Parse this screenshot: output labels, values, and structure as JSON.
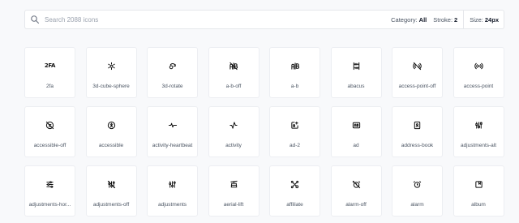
{
  "search": {
    "placeholder": "Search 2088 icons",
    "value": ""
  },
  "filters": {
    "category_label": "Category:",
    "category_value": "All",
    "stroke_label": "Stroke:",
    "stroke_value": "2",
    "size_label": "Size:",
    "size_value": "24px"
  },
  "icons": [
    {
      "label": "2fa",
      "icon": "2fa-icon"
    },
    {
      "label": "3d-cube-sphere",
      "icon": "3d-cube-sphere-icon"
    },
    {
      "label": "3d-rotate",
      "icon": "3d-rotate-icon"
    },
    {
      "label": "a-b-off",
      "icon": "a-b-off-icon"
    },
    {
      "label": "a-b",
      "icon": "a-b-icon"
    },
    {
      "label": "abacus",
      "icon": "abacus-icon"
    },
    {
      "label": "access-point-off",
      "icon": "access-point-off-icon"
    },
    {
      "label": "access-point",
      "icon": "access-point-icon"
    },
    {
      "label": "accessible-off",
      "icon": "accessible-off-icon"
    },
    {
      "label": "accessible",
      "icon": "accessible-icon"
    },
    {
      "label": "activity-heartbeat",
      "icon": "activity-heartbeat-icon"
    },
    {
      "label": "activity",
      "icon": "activity-icon"
    },
    {
      "label": "ad-2",
      "icon": "ad-2-icon"
    },
    {
      "label": "ad",
      "icon": "ad-icon"
    },
    {
      "label": "address-book",
      "icon": "address-book-icon"
    },
    {
      "label": "adjustments-alt",
      "icon": "adjustments-alt-icon"
    },
    {
      "label": "adjustments-hor...",
      "icon": "adjustments-horizontal-icon"
    },
    {
      "label": "adjustments-off",
      "icon": "adjustments-off-icon"
    },
    {
      "label": "adjustments",
      "icon": "adjustments-icon"
    },
    {
      "label": "aerial-lift",
      "icon": "aerial-lift-icon"
    },
    {
      "label": "affiliate",
      "icon": "affiliate-icon"
    },
    {
      "label": "alarm-off",
      "icon": "alarm-off-icon"
    },
    {
      "label": "alarm",
      "icon": "alarm-icon"
    },
    {
      "label": "album",
      "icon": "album-icon"
    }
  ]
}
